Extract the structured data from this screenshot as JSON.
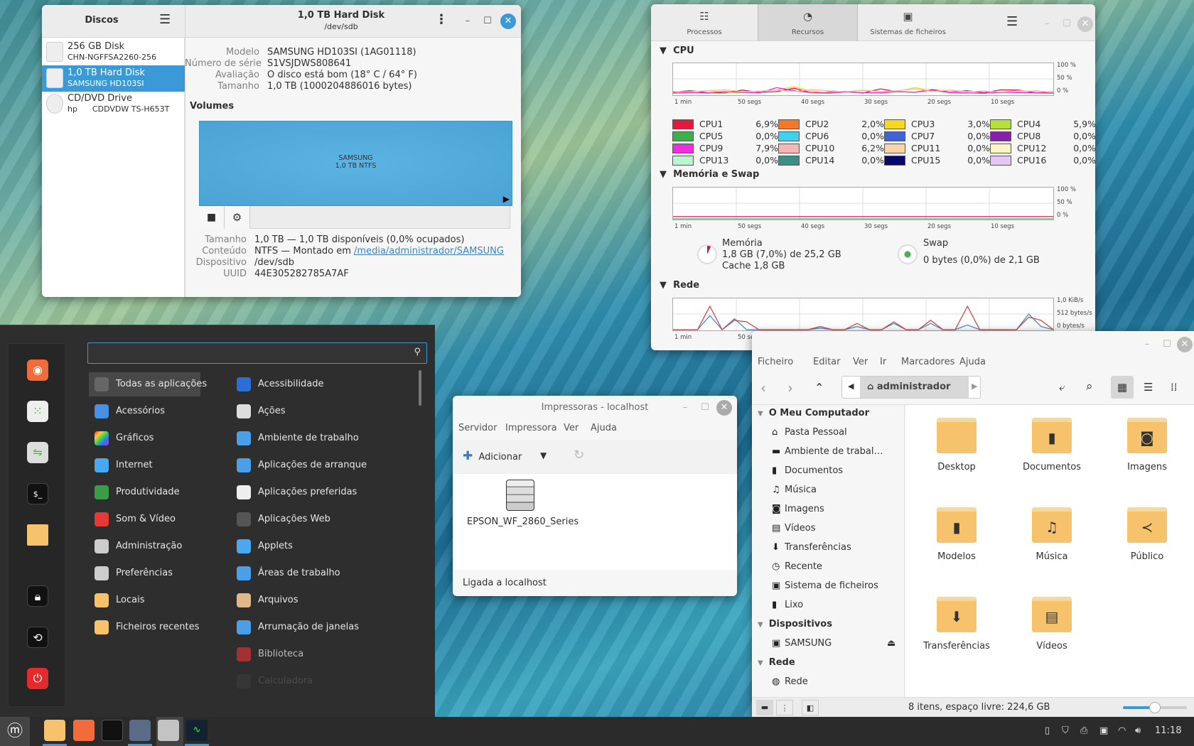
{
  "disks": {
    "title": "Discos",
    "header_title": "1,0 TB Hard Disk",
    "header_subtitle": "/dev/sdb",
    "drives": [
      {
        "name": "256 GB Disk",
        "sub": "CHN-NGFFSA2260-256"
      },
      {
        "name": "1,0 TB Hard Disk",
        "sub": "SAMSUNG HD103SI",
        "selected": true
      },
      {
        "name": "CD/DVD Drive",
        "sub": "hp      CDDVDW TS-H653T"
      }
    ],
    "info": [
      {
        "label": "Modelo",
        "value": "SAMSUNG HD103SI (1AG01118)"
      },
      {
        "label": "Número de série",
        "value": "S1VSJDWS808641"
      },
      {
        "label": "Avaliação",
        "value": "O disco está bom (18° C / 64° F)"
      },
      {
        "label": "Tamanho",
        "value": "1,0 TB (1000204886016 bytes)"
      }
    ],
    "volumes_title": "Volumes",
    "volume_name": "SAMSUNG",
    "volume_desc": "1,0 TB NTFS",
    "vol_info": {
      "size_label": "Tamanho",
      "size": "1,0 TB — 1,0 TB disponíveis (0,0% ocupados)",
      "content_label": "Conteúdo",
      "content_prefix": "NTFS — Montado em ",
      "content_link": "/media/administrador/SAMSUNG",
      "device_label": "Dispositivo",
      "device": "/dev/sdb",
      "uuid_label": "UUID",
      "uuid": "44E305282785A7AF"
    },
    "accent": "#3b99d8"
  },
  "sysmon": {
    "tabs": [
      "Processos",
      "Recursos",
      "Sistemas de ficheiros"
    ],
    "active_tab": "Recursos",
    "cpu_title": "CPU",
    "mem_title": "Memória e Swap",
    "net_title": "Rede",
    "time_ticks": [
      "1 min",
      "50 segs",
      "40 segs",
      "30 segs",
      "20 segs",
      "10 segs"
    ],
    "pct_ticks": [
      "100 %",
      "50 %",
      "0 %"
    ],
    "net_ticks": [
      "1,0 KiB/s",
      "512 bytes/s",
      "0 bytes/s"
    ],
    "cpus": [
      {
        "name": "CPU1",
        "value": "6,9%",
        "color": "#e01b3c"
      },
      {
        "name": "CPU2",
        "value": "2,0%",
        "color": "#f5782a"
      },
      {
        "name": "CPU3",
        "value": "3,0%",
        "color": "#f8d81c"
      },
      {
        "name": "CPU4",
        "value": "5,9%",
        "color": "#b5e03a"
      },
      {
        "name": "CPU5",
        "value": "0,0%",
        "color": "#3bb04c"
      },
      {
        "name": "CPU6",
        "value": "0,0%",
        "color": "#3fd1ee"
      },
      {
        "name": "CPU7",
        "value": "0,0%",
        "color": "#3f62d8"
      },
      {
        "name": "CPU8",
        "value": "0,0%",
        "color": "#8a1fae"
      },
      {
        "name": "CPU9",
        "value": "7,9%",
        "color": "#ea2ee0"
      },
      {
        "name": "CPU10",
        "value": "6,2%",
        "color": "#f7b5b5"
      },
      {
        "name": "CPU11",
        "value": "0,0%",
        "color": "#fbd3a7"
      },
      {
        "name": "CPU12",
        "value": "0,0%",
        "color": "#fdf6c3"
      },
      {
        "name": "CPU13",
        "value": "0,0%",
        "color": "#b8f7cf"
      },
      {
        "name": "CPU14",
        "value": "0,0%",
        "color": "#3b9084"
      },
      {
        "name": "CPU15",
        "value": "0,0%",
        "color": "#07076c"
      },
      {
        "name": "CPU16",
        "value": "0,0%",
        "color": "#e4c6f7"
      }
    ],
    "cpu_history": [
      {
        "cpu": "CPU1",
        "values": [
          8,
          12,
          6,
          5,
          14,
          7,
          9,
          20,
          6,
          8,
          10,
          5,
          18,
          9,
          7,
          16,
          8,
          12,
          6,
          15,
          14,
          5,
          8
        ]
      },
      {
        "cpu": "CPU3",
        "values": [
          5,
          9,
          12,
          7,
          6,
          10,
          15,
          25,
          11,
          6,
          9,
          14,
          8,
          10,
          22,
          12,
          7,
          9,
          11,
          6,
          8,
          12,
          6
        ]
      },
      {
        "cpu": "CPU9",
        "values": [
          4,
          6,
          5,
          9,
          7,
          5,
          22,
          12,
          6,
          4,
          8,
          6,
          5,
          9,
          7,
          14,
          6,
          5,
          4,
          7,
          6,
          5,
          4
        ]
      },
      {
        "cpu": "CPU10",
        "values": [
          10,
          8,
          12,
          15,
          9,
          11,
          14,
          10,
          16,
          12,
          9,
          13,
          10,
          12,
          18,
          10,
          14,
          9,
          11,
          8,
          12,
          10,
          9
        ]
      }
    ],
    "memory": {
      "label": "Memória",
      "value": "1,8 GB (7,0%) de 25,2 GB",
      "cache": "Cache 1,8 GB",
      "percent": 7.0,
      "color": "#c2185b"
    },
    "swap": {
      "label": "Swap",
      "value": "0 bytes (0,0%) de 2,1 GB",
      "percent": 0.0,
      "color": "#4caf50"
    },
    "net_history": {
      "received": [
        0,
        0,
        0,
        75,
        0,
        30,
        25,
        0,
        0,
        0,
        0,
        0,
        10,
        0,
        0,
        20,
        0,
        0,
        25,
        0,
        0,
        30,
        0,
        0,
        75,
        0,
        0,
        0,
        0,
        40,
        30,
        0
      ],
      "sent": [
        0,
        0,
        0,
        45,
        0,
        35,
        0,
        0,
        0,
        0,
        0,
        0,
        5,
        0,
        0,
        10,
        0,
        0,
        20,
        0,
        0,
        20,
        0,
        0,
        15,
        0,
        0,
        0,
        0,
        50,
        10,
        0
      ],
      "received_color": "#e0433c",
      "sent_color": "#3c8ee0"
    }
  },
  "files": {
    "menu": [
      "Ficheiro",
      "Editar",
      "Ver",
      "Ir",
      "Marcadores",
      "Ajuda"
    ],
    "location": "administrador",
    "sections": [
      {
        "title": "O Meu Computador",
        "items": [
          "Pasta Pessoal",
          "Ambiente de trabal…",
          "Documentos",
          "Música",
          "Imagens",
          "Vídeos",
          "Transferências",
          "Recente",
          "Sistema de ficheiros",
          "Lixo"
        ]
      },
      {
        "title": "Dispositivos",
        "items": [
          "SAMSUNG"
        ]
      },
      {
        "title": "Rede",
        "items": [
          "Rede"
        ]
      }
    ],
    "folders": [
      "Desktop",
      "Documentos",
      "Imagens",
      "Modelos",
      "Música",
      "Público",
      "Transferências",
      "Vídeos"
    ],
    "status": "8 itens, espaço livre: 224,6 GB",
    "zoom_level": 0.5
  },
  "printers": {
    "title": "Impressoras - localhost",
    "menu": [
      "Servidor",
      "Impressora",
      "Ver",
      "Ajuda"
    ],
    "add_label": "Adicionar",
    "printer": "EPSON_WF_2860_Series",
    "status": "Ligada a localhost"
  },
  "menu": {
    "search_placeholder": "",
    "categories_left": [
      "Todas as aplicações",
      "Acessórios",
      "Gráficos",
      "Internet",
      "Produtividade",
      "Som & Vídeo",
      "Administração",
      "Preferências",
      "Locais",
      "Ficheiros recentes"
    ],
    "categories_right": [
      "Acessibilidade",
      "Ações",
      "Ambiente de trabalho",
      "Aplicações de arranque",
      "Aplicações preferidas",
      "Aplicações Web",
      "Applets",
      "Áreas de trabalho",
      "Arquivos",
      "Arrumação de janelas",
      "Biblioteca",
      "Calculadora"
    ]
  },
  "taskbar": {
    "clock": "11:18"
  }
}
